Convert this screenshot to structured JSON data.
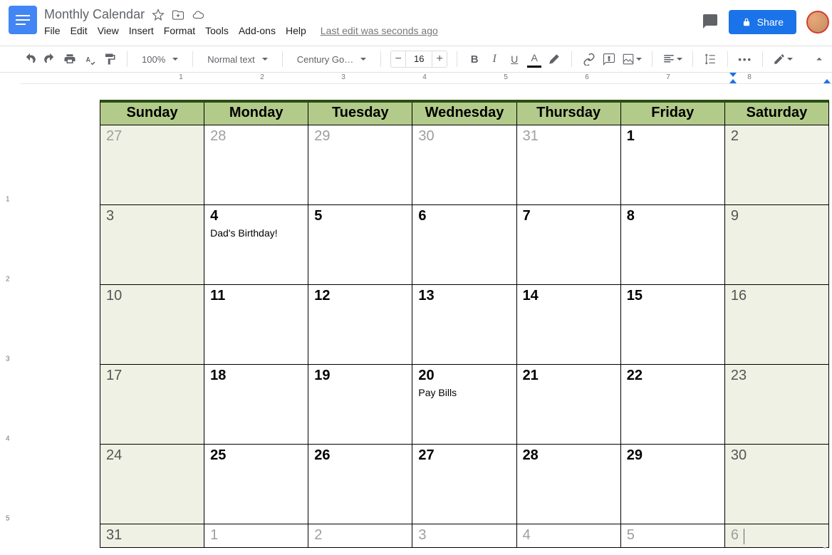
{
  "header": {
    "title": "Monthly Calendar",
    "menu": [
      "File",
      "Edit",
      "View",
      "Insert",
      "Format",
      "Tools",
      "Add-ons",
      "Help"
    ],
    "last_edit": "Last edit was seconds ago",
    "share_label": "Share"
  },
  "toolbar": {
    "zoom": "100%",
    "style": "Normal text",
    "font": "Century Go…",
    "font_size": "16",
    "more": "•••"
  },
  "ruler": {
    "h": [
      "1",
      "2",
      "3",
      "4",
      "5",
      "6",
      "7",
      "8"
    ],
    "v": [
      "1",
      "2",
      "3",
      "4",
      "5"
    ]
  },
  "calendar": {
    "weekdays": [
      "Sunday",
      "Monday",
      "Tuesday",
      "Wednesday",
      "Thursday",
      "Friday",
      "Saturday"
    ],
    "rows": [
      [
        {
          "n": "27",
          "muted": true,
          "weekend": true
        },
        {
          "n": "28",
          "muted": true
        },
        {
          "n": "29",
          "muted": true
        },
        {
          "n": "30",
          "muted": true
        },
        {
          "n": "31",
          "muted": true
        },
        {
          "n": "1"
        },
        {
          "n": "2",
          "weekend": true,
          "wdark": true
        }
      ],
      [
        {
          "n": "3",
          "weekend": true,
          "wdark": true
        },
        {
          "n": "4",
          "event": "Dad's Birthday!"
        },
        {
          "n": "5"
        },
        {
          "n": "6"
        },
        {
          "n": "7"
        },
        {
          "n": "8"
        },
        {
          "n": "9",
          "weekend": true,
          "wdark": true
        }
      ],
      [
        {
          "n": "10",
          "weekend": true,
          "wdark": true
        },
        {
          "n": "11"
        },
        {
          "n": "12"
        },
        {
          "n": "13"
        },
        {
          "n": "14"
        },
        {
          "n": "15"
        },
        {
          "n": "16",
          "weekend": true,
          "wdark": true
        }
      ],
      [
        {
          "n": "17",
          "weekend": true,
          "wdark": true
        },
        {
          "n": "18"
        },
        {
          "n": "19"
        },
        {
          "n": "20",
          "event": "Pay Bills"
        },
        {
          "n": "21"
        },
        {
          "n": "22"
        },
        {
          "n": "23",
          "weekend": true,
          "wdark": true
        }
      ],
      [
        {
          "n": "24",
          "weekend": true,
          "wdark": true
        },
        {
          "n": "25"
        },
        {
          "n": "26"
        },
        {
          "n": "27"
        },
        {
          "n": "28"
        },
        {
          "n": "29"
        },
        {
          "n": "30",
          "weekend": true,
          "wdark": true
        }
      ],
      [
        {
          "n": "31",
          "weekend": true,
          "wdark": true
        },
        {
          "n": "1",
          "muted": true
        },
        {
          "n": "2",
          "muted": true
        },
        {
          "n": "3",
          "muted": true
        },
        {
          "n": "4",
          "muted": true
        },
        {
          "n": "5",
          "muted": true
        },
        {
          "n": "6",
          "muted": true,
          "weekend": true,
          "cursor": true
        }
      ]
    ]
  }
}
